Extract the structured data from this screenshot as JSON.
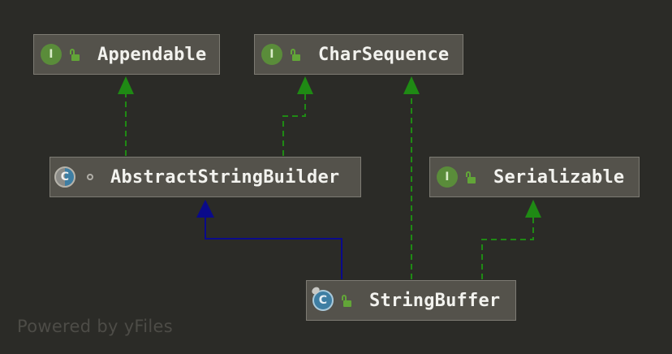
{
  "diagram": {
    "nodes": [
      {
        "id": "appendable",
        "name": "Appendable",
        "kind": "interface"
      },
      {
        "id": "charsequence",
        "name": "CharSequence",
        "kind": "interface"
      },
      {
        "id": "abstractstringbuilder",
        "name": "AbstractStringBuilder",
        "kind": "abstract-class"
      },
      {
        "id": "serializable",
        "name": "Serializable",
        "kind": "interface"
      },
      {
        "id": "stringbuffer",
        "name": "StringBuffer",
        "kind": "class"
      }
    ],
    "edges": [
      {
        "from": "abstractstringbuilder",
        "to": "appendable",
        "type": "implements"
      },
      {
        "from": "abstractstringbuilder",
        "to": "charsequence",
        "type": "implements"
      },
      {
        "from": "stringbuffer",
        "to": "abstractstringbuilder",
        "type": "extends"
      },
      {
        "from": "stringbuffer",
        "to": "charsequence",
        "type": "implements"
      },
      {
        "from": "stringbuffer",
        "to": "serializable",
        "type": "implements"
      }
    ],
    "badges": {
      "interface": "I",
      "class": "C"
    },
    "colors": {
      "background": "#2b2b27",
      "node_fill": "#54524b",
      "implements_edge": "#1f8a14",
      "extends_edge": "#0a0a8a"
    },
    "icons": {
      "interface": "interface-icon",
      "class": "class-icon",
      "abstract-class": "abstract-class-icon",
      "public": "lock-open-icon"
    }
  },
  "watermark": "Powered by yFiles"
}
